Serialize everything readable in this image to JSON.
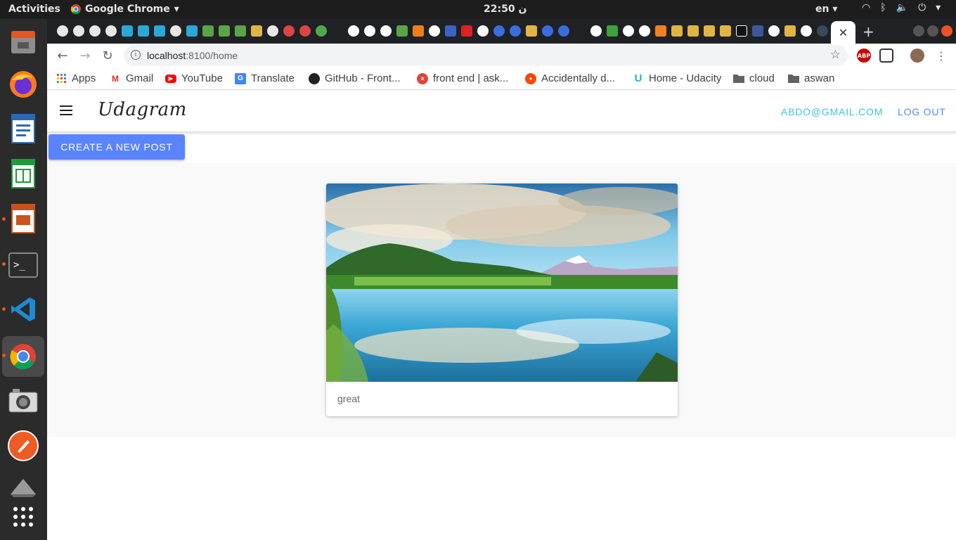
{
  "system": {
    "activities": "Activities",
    "app_menu": "Google Chrome",
    "clock": "ن 22:50",
    "language": "en"
  },
  "browser": {
    "url_host": "localhost",
    "url_path": ":8100/home",
    "bookmarks": [
      {
        "label": "Apps",
        "icon": "apps-grid-icon"
      },
      {
        "label": "Gmail",
        "icon": "gmail-icon"
      },
      {
        "label": "YouTube",
        "icon": "youtube-icon"
      },
      {
        "label": "Translate",
        "icon": "translate-icon"
      },
      {
        "label": "GitHub - Front...",
        "icon": "github-icon"
      },
      {
        "label": "front end | ask...",
        "icon": "askfm-icon"
      },
      {
        "label": "Accidentally d...",
        "icon": "reddit-icon"
      },
      {
        "label": "Home - Udacity",
        "icon": "udacity-icon"
      },
      {
        "label": "cloud",
        "icon": "folder-icon"
      },
      {
        "label": "aswan",
        "icon": "folder-icon"
      }
    ]
  },
  "app": {
    "title": "Udagram",
    "user_email": "ABDO@GMAIL.COM",
    "logout_label": "LOG OUT",
    "create_post_label": "CREATE A NEW POST",
    "posts": [
      {
        "caption": "great"
      }
    ]
  },
  "colors": {
    "primary": "#5a83ff",
    "secondary": "#3dc2d9",
    "ubuntu_accent": "#e95420"
  }
}
